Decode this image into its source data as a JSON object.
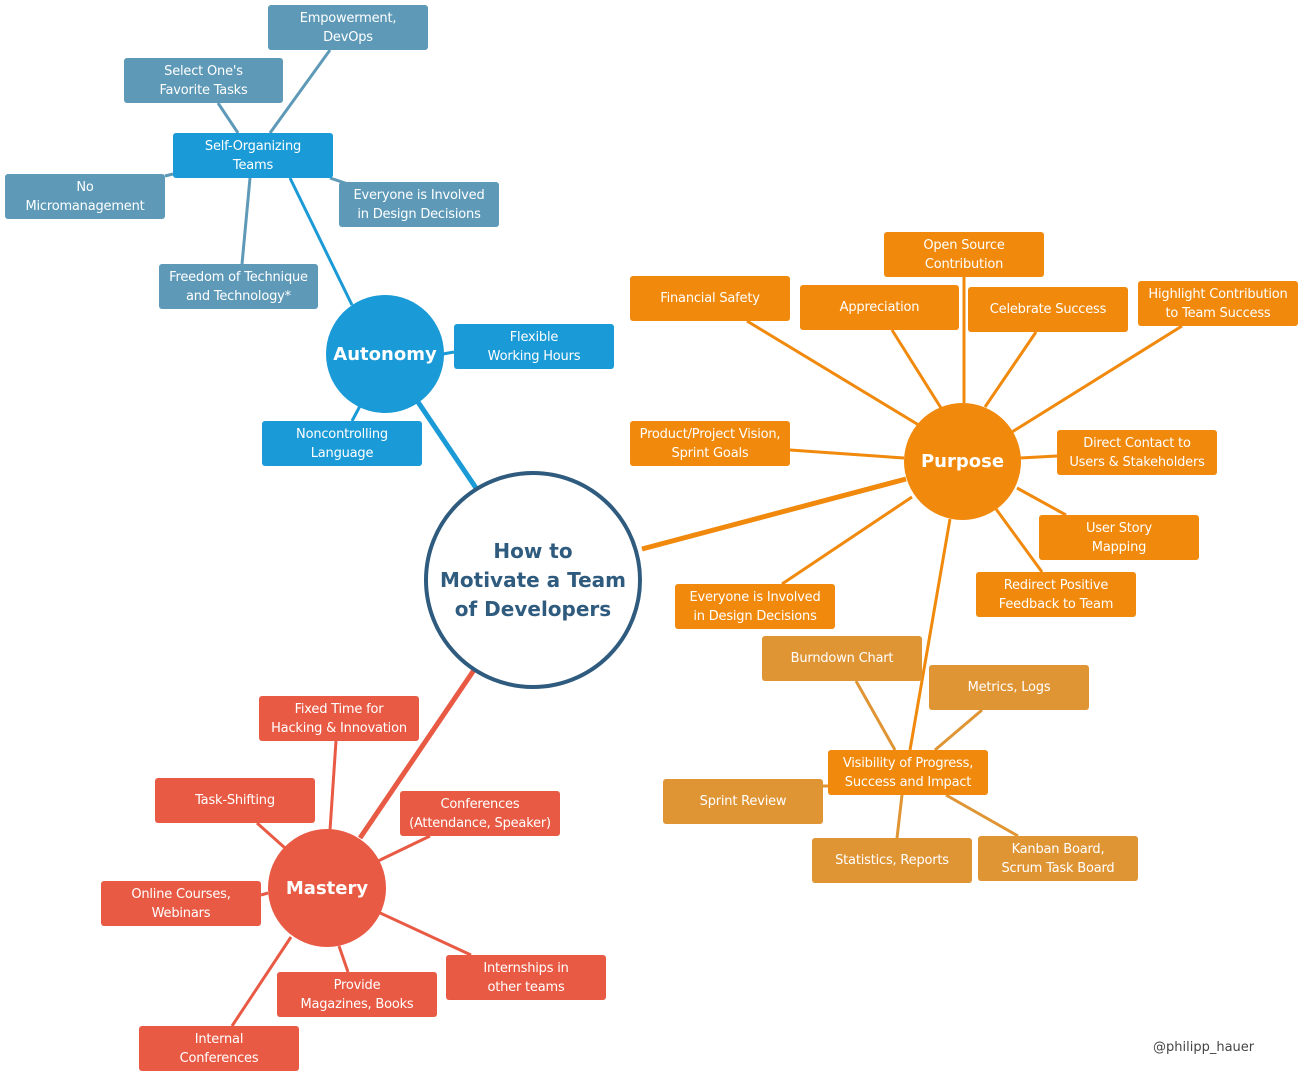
{
  "title": "How to\nMotivate a Team\nof Developers",
  "colors": {
    "center": "#2f5b7f",
    "autonomy": "#1a9ad6",
    "autonomy_sub": "#5e9ab8",
    "purpose": "#f0890c",
    "purpose_sub": "#e09535",
    "mastery": "#e85a44"
  },
  "autonomy": {
    "label": "Autonomy",
    "children": {
      "self_organizing": "Self-Organizing\nTeams",
      "flexible_hours": "Flexible\nWorking Hours",
      "noncontrolling": "Noncontrolling\nLanguage"
    },
    "self_organizing_children": {
      "empowerment": "Empowerment,\nDevOps",
      "select_tasks": "Select One's\nFavorite Tasks",
      "no_micromanagement": "No\nMicromanagement",
      "design_decisions": "Everyone is Involved\nin Design Decisions",
      "freedom": "Freedom of Technique\nand Technology*"
    }
  },
  "purpose": {
    "label": "Purpose",
    "children": {
      "open_source": "Open Source\nContribution",
      "financial_safety": "Financial Safety",
      "appreciation": "Appreciation",
      "celebrate": "Celebrate Success",
      "highlight": "Highlight Contribution\nto Team Success",
      "vision": "Product/Project Vision,\nSprint Goals",
      "direct_contact": "Direct Contact to\nUsers & Stakeholders",
      "user_story": "User Story\nMapping",
      "redirect_feedback": "Redirect Positive\nFeedback to Team",
      "design_decisions": "Everyone is Involved\nin Design Decisions",
      "visibility": "Visibility of Progress,\nSuccess and Impact"
    },
    "visibility_children": {
      "burndown": "Burndown Chart",
      "metrics": "Metrics, Logs",
      "sprint_review": "Sprint Review",
      "statistics": "Statistics, Reports",
      "kanban": "Kanban Board,\nScrum Task Board"
    }
  },
  "mastery": {
    "label": "Mastery",
    "children": {
      "fixed_time": "Fixed Time for\nHacking & Innovation",
      "task_shifting": "Task-Shifting",
      "conferences": "Conferences\n(Attendance, Speaker)",
      "online_courses": "Online Courses,\nWebinars",
      "internships": "Internships in\nother teams",
      "magazines": "Provide\nMagazines, Books",
      "internal_conf": "Internal\nConferences"
    }
  },
  "credit": "@philipp_hauer"
}
